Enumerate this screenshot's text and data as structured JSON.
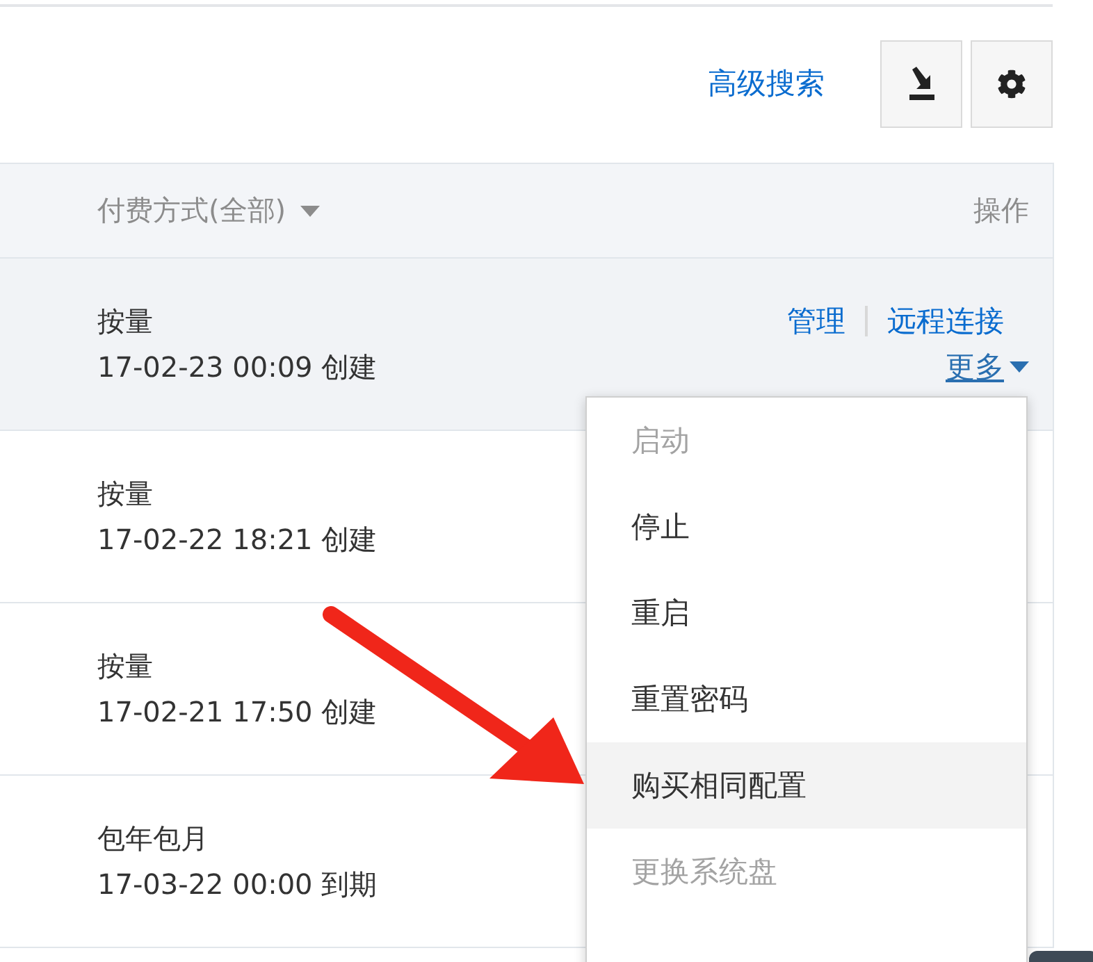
{
  "toolbar": {
    "advanced_search": "高级搜索"
  },
  "table": {
    "columns": [
      {
        "label": "付费方式(全部)",
        "kind": "filter"
      },
      {
        "label": "操作",
        "kind": "plain"
      }
    ],
    "rows": [
      {
        "billing": "按量",
        "time": "17-02-23 00:09 创建",
        "highlighted": true,
        "actions": {
          "links": [
            "管理",
            "远程连接"
          ],
          "more": "更多"
        }
      },
      {
        "billing": "按量",
        "time": "17-02-22 18:21 创建",
        "highlighted": false
      },
      {
        "billing": "按量",
        "time": "17-02-21 17:50 创建",
        "highlighted": false
      },
      {
        "billing": "包年包月",
        "time": "17-03-22 00:00 到期",
        "highlighted": false
      }
    ]
  },
  "menu": {
    "items": [
      {
        "label": "启动",
        "disabled": true,
        "highlighted": false
      },
      {
        "label": "停止",
        "disabled": false,
        "highlighted": false
      },
      {
        "label": "重启",
        "disabled": false,
        "highlighted": false
      },
      {
        "label": "重置密码",
        "disabled": false,
        "highlighted": false
      },
      {
        "label": "购买相同配置",
        "disabled": false,
        "highlighted": true
      },
      {
        "label": "更换系统盘",
        "disabled": true,
        "highlighted": false
      }
    ]
  }
}
